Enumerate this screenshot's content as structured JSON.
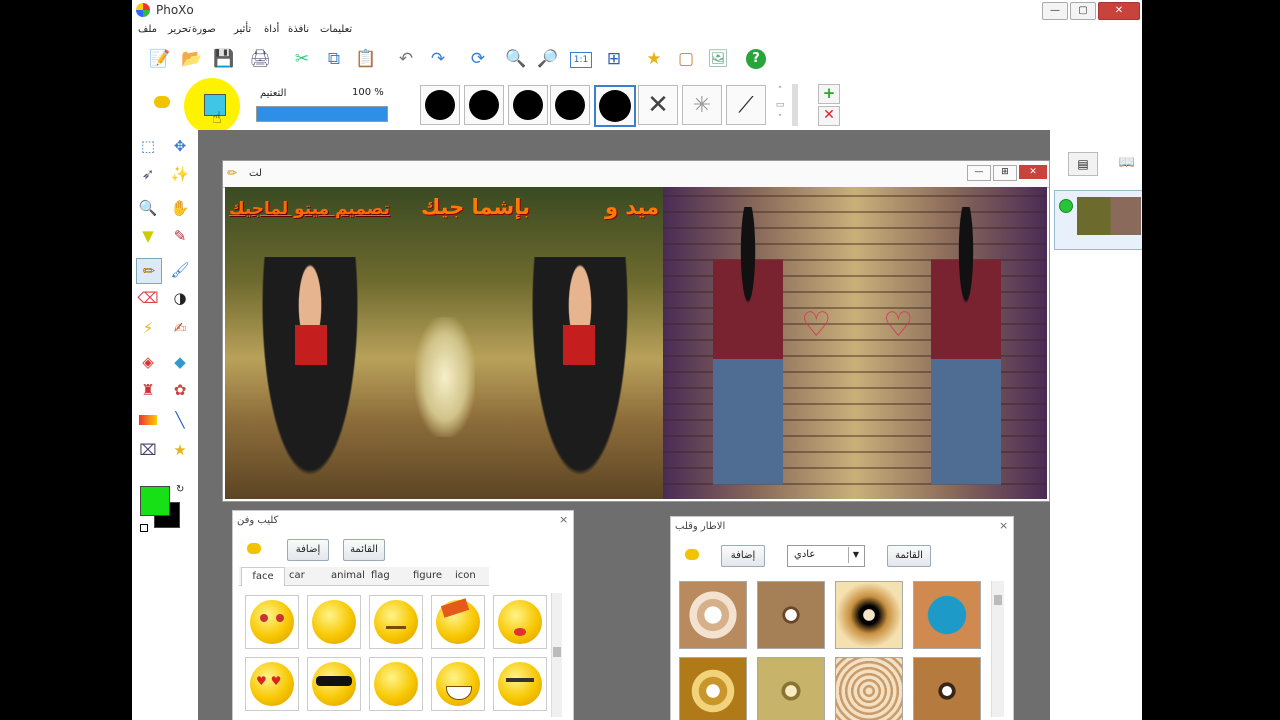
{
  "window": {
    "title": "PhoXo",
    "controls": {
      "minimize": "—",
      "maximize": "▢",
      "close": "✕"
    }
  },
  "menu": [
    "ملف",
    "تحرير",
    "صورة",
    "تأثير",
    "أداة",
    "نافذة",
    "تعليمات"
  ],
  "options_bar": {
    "opacity_label": "التعتيم",
    "opacity_value": "100 %",
    "opacity_fraction": 1.0,
    "fg_swatch_color": "#3fc6e6",
    "brush_sizes": [
      30,
      30,
      30,
      30,
      32
    ],
    "selected_brush_index": 4
  },
  "toolbox": {
    "foreground_color": "#17e017",
    "background_color": "#000000"
  },
  "image_window": {
    "title": "لت",
    "overlay_text": {
      "line_left": "تصميم ميتو لماجيك",
      "line_center": "بإشما جيك",
      "line_right": "ميد و"
    }
  },
  "sticker_panel": {
    "title": "كليب وفن",
    "add_button": "إضافة",
    "list_button": "القائمة",
    "tabs": [
      "face",
      "car",
      "animal",
      "flag",
      "figure",
      "icon"
    ],
    "active_tab": "face"
  },
  "frame_panel": {
    "title": "الاطار وقلب",
    "add_button": "إضافة",
    "dropdown_value": "عادي",
    "list_button": "القائمة"
  },
  "colors": {
    "accent_highlight": "#fff200",
    "opacity_bar": "#2f8ee6"
  }
}
